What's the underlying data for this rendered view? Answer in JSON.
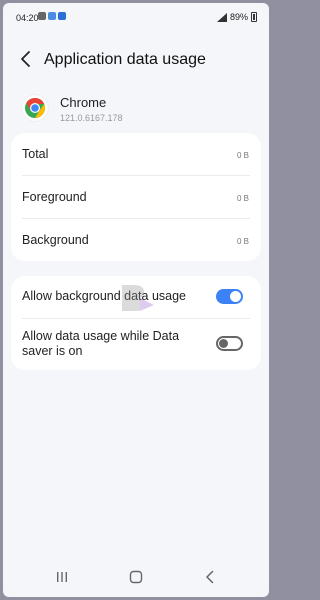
{
  "status_bar": {
    "time": "04:20",
    "battery": "89%"
  },
  "header": {
    "title": "Application data usage"
  },
  "app": {
    "name": "Chrome",
    "version": "121.0.6167.178"
  },
  "usage": [
    {
      "label": "Total",
      "value": "0 B"
    },
    {
      "label": "Foreground",
      "value": "0 B"
    },
    {
      "label": "Background",
      "value": "0 B"
    }
  ],
  "settings": [
    {
      "label": "Allow background data usage",
      "enabled": true
    },
    {
      "label": "Allow data usage while Data saver is on",
      "enabled": false
    }
  ],
  "colors": {
    "accent": "#3c82f6",
    "background": "#f5f6fa",
    "card": "#ffffff"
  },
  "icons": [
    "back-arrow-icon",
    "chrome-logo-icon",
    "recents-icon",
    "home-icon",
    "nav-back-icon"
  ]
}
